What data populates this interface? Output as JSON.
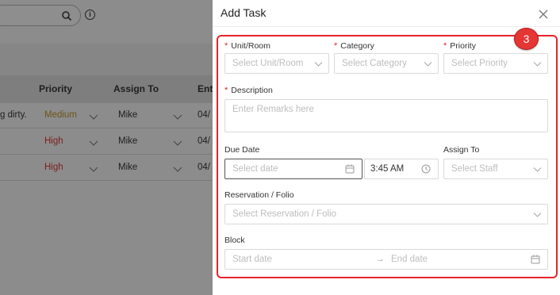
{
  "background": {
    "columns": [
      "Priority",
      "Assign To",
      "Ent"
    ],
    "rows": [
      {
        "desc": "g dirty.",
        "priority": "Medium",
        "assignee": "Mike",
        "date": "04/"
      },
      {
        "desc": "",
        "priority": "High",
        "assignee": "Mike",
        "date": "04/"
      },
      {
        "desc": "",
        "priority": "High",
        "assignee": "Mike",
        "date": "04/"
      }
    ]
  },
  "modal": {
    "title": "Add Task",
    "step_badge": "3",
    "unit_room": {
      "label": "Unit/Room",
      "placeholder": "Select Unit/Room"
    },
    "category": {
      "label": "Category",
      "placeholder": "Select Category"
    },
    "priority": {
      "label": "Priority",
      "placeholder": "Select Priority"
    },
    "description": {
      "label": "Description",
      "placeholder": "Enter Remarks here"
    },
    "due_date": {
      "label": "Due Date",
      "placeholder": "Select date",
      "time": "3:45 AM"
    },
    "assign_to": {
      "label": "Assign To",
      "placeholder": "Select Staff"
    },
    "reservation": {
      "label": "Reservation / Folio",
      "placeholder": "Select Reservation / Folio"
    },
    "block": {
      "label": "Block",
      "start_placeholder": "Start date",
      "arrow": "→",
      "end_placeholder": "End date"
    }
  },
  "icons": [
    "search-icon",
    "info-icon",
    "close-icon",
    "chevron-down-icon",
    "calendar-icon",
    "clock-icon",
    "arrow-right-icon"
  ],
  "colors": {
    "required": "#e8232a",
    "highlight": "#e8232a",
    "badge": "#e63535"
  }
}
